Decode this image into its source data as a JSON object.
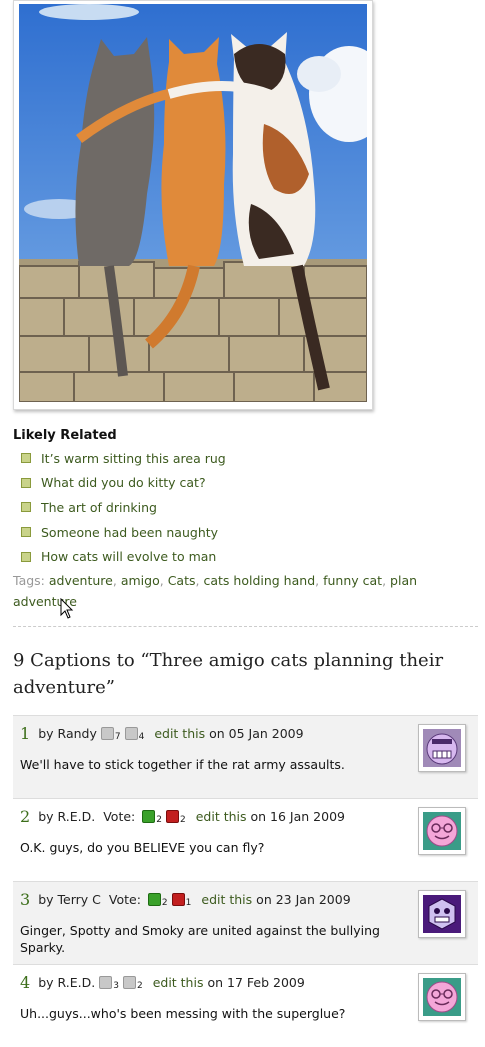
{
  "photo": {
    "alt": "Three cats sitting on a stone wall"
  },
  "related": {
    "title": "Likely Related",
    "items": [
      "It’s warm sitting this area rug",
      "What did you do kitty cat?",
      "The art of drinking",
      "Someone had been naughty",
      "How cats will evolve to man"
    ]
  },
  "tags": {
    "label": "Tags:",
    "items": [
      "adventure",
      "amigo",
      "Cats",
      "cats holding hand",
      "funny cat",
      "plan adventure"
    ]
  },
  "captions": {
    "heading": "9 Captions to “Three amigo cats planning their adventure”",
    "items": [
      {
        "num": "1",
        "author": "Randy",
        "vote_label": "",
        "up": "7",
        "down": "4",
        "active": false,
        "edit": "edit this",
        "date": "on 05 Jan 2009",
        "text": "We'll have to stick together if the rat army assaults.",
        "avatar": "grimace-face"
      },
      {
        "num": "2",
        "author": "R.E.D.",
        "vote_label": "Vote:",
        "up": "2",
        "down": "2",
        "active": true,
        "edit": "edit this",
        "date": "on 16 Jan 2009",
        "text": "O.K. guys, do you BELIEVE you can fly?",
        "avatar": "glasses-face"
      },
      {
        "num": "3",
        "author": "Terry C",
        "vote_label": "Vote:",
        "up": "2",
        "down": "1",
        "active": true,
        "edit": "edit this",
        "date": "on 23 Jan 2009",
        "text": "Ginger, Spotty and Smoky are united against the bullying Sparky.",
        "avatar": "hexagon-face"
      },
      {
        "num": "4",
        "author": "R.E.D.",
        "vote_label": "",
        "up": "3",
        "down": "2",
        "active": false,
        "edit": "edit this",
        "date": "on 17 Feb 2009",
        "text": "Uh...guys...who's been messing with the superglue?",
        "avatar": "glasses-face"
      }
    ]
  },
  "colors": {
    "link": "#3c5a1e",
    "vote_up": "#3aa12a",
    "vote_down": "#c21f1f"
  }
}
